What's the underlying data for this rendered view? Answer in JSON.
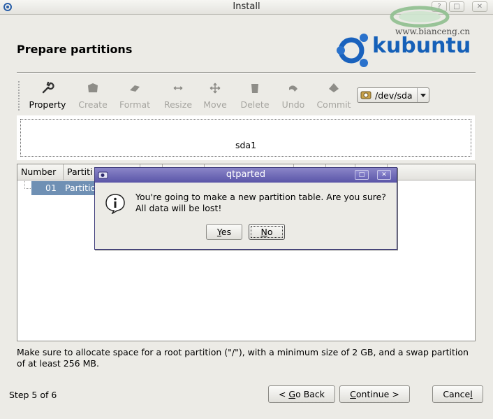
{
  "window": {
    "title": "Install"
  },
  "watermark": {
    "text": "www.bianceng.cn"
  },
  "page": {
    "heading": "Prepare partitions",
    "logo_text": "kubuntu"
  },
  "toolbar": {
    "buttons": [
      {
        "label": "Property",
        "icon": "wrench-icon",
        "enabled": true
      },
      {
        "label": "Create",
        "icon": "create-icon",
        "enabled": false
      },
      {
        "label": "Format",
        "icon": "format-icon",
        "enabled": false
      },
      {
        "label": "Resize",
        "icon": "resize-icon",
        "enabled": false
      },
      {
        "label": "Move",
        "icon": "move-icon",
        "enabled": false
      },
      {
        "label": "Delete",
        "icon": "delete-icon",
        "enabled": false
      },
      {
        "label": "Undo",
        "icon": "undo-icon",
        "enabled": false
      },
      {
        "label": "Commit",
        "icon": "commit-icon",
        "enabled": false
      }
    ],
    "device_select": {
      "value": "/dev/sda"
    }
  },
  "disk_map": {
    "label": "sda1"
  },
  "partition_list": {
    "columns": [
      "Number",
      "Partiti"
    ],
    "rows": [
      {
        "number": "01",
        "partition": "Partitio"
      }
    ]
  },
  "note": "Make sure to allocate space for a root partition (\"/\"), with a minimum size of 2 GB, and a swap partition of at least 256 MB.",
  "footer": {
    "step": "Step 5 of 6",
    "back_pre": "< ",
    "back_ul": "G",
    "back_post": "o Back",
    "continue_ul": "C",
    "continue_post": "ontinue >",
    "cancel_pre": "Cance",
    "cancel_ul": "l"
  },
  "dialog": {
    "title": "qtparted",
    "message_line1": "You're going to make a new partition table. Are you sure?",
    "message_line2": "All data will be lost!",
    "yes_ul": "Y",
    "yes_post": "es",
    "no_ul": "N",
    "no_post": "o"
  },
  "colors": {
    "dialog_title": "#6a65b8",
    "selection": "#6f90b4",
    "brand": "#1560b8"
  }
}
